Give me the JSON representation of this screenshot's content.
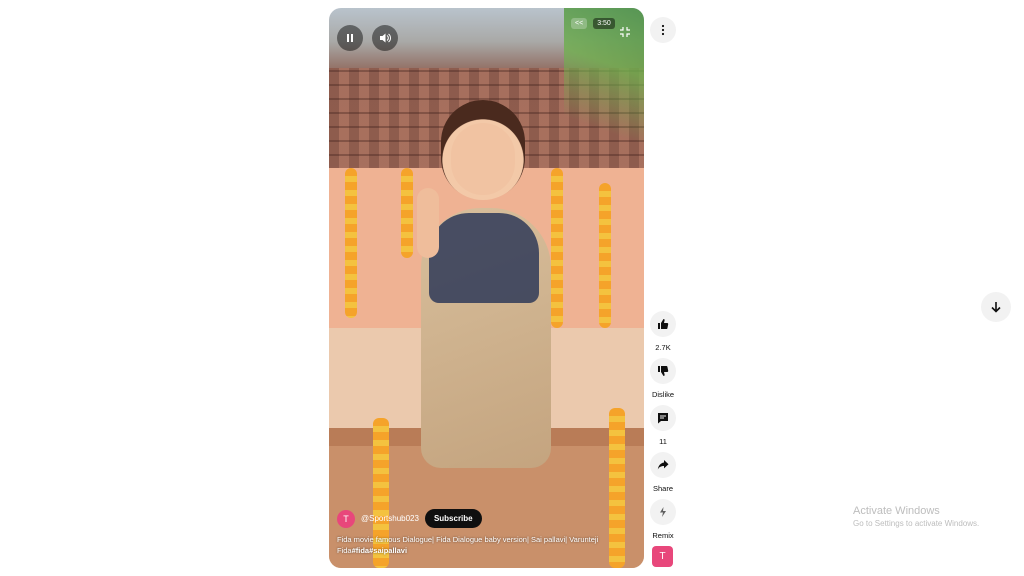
{
  "player": {
    "seek_back_label": "<<",
    "time": "3:50",
    "pause_icon": "pause-icon",
    "volume_icon": "volume-icon",
    "fullscreen_icon": "fullscreen-exit-icon"
  },
  "video": {
    "channel_avatar_letter": "T",
    "channel_name": "@Sportshub023",
    "subscribe_label": "Subscribe",
    "description_plain": "Fida movie famous Dialogue| Fida Dialogue baby version| Sai pallavi| Varunteji Fida",
    "hashtags": "#fida#saipallavi"
  },
  "actions": {
    "like_count": "2.7K",
    "dislike_label": "Dislike",
    "comments_count": "11",
    "share_label": "Share",
    "remix_label": "Remix",
    "remix_avatar_letter": "T"
  },
  "watermark": {
    "line1": "Activate Windows",
    "line2": "Go to Settings to activate Windows."
  },
  "colors": {
    "avatar": "#e8477b",
    "subscribe_bg": "#0f0f0f",
    "action_bg": "#f2f2f2"
  }
}
